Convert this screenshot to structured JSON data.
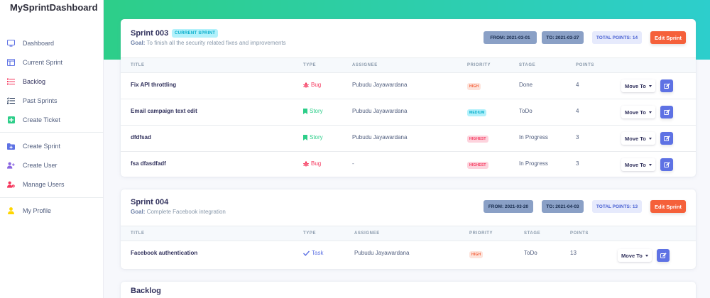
{
  "app": {
    "title": "MySprintDashboard",
    "accent": "#5e72e4",
    "hero_gradient": [
      "#2dce89",
      "#2dcecc"
    ]
  },
  "sidebar": {
    "items": [
      {
        "label": "Dashboard",
        "icon": "monitor-icon",
        "color": "#5e72e4"
      },
      {
        "label": "Current Sprint",
        "icon": "sprint-board-icon",
        "color": "#5e72e4"
      },
      {
        "label": "Backlog",
        "icon": "list-icon",
        "color": "#f5365c",
        "active": true
      },
      {
        "label": "Past Sprints",
        "icon": "checklist-icon",
        "color": "#172b4d"
      },
      {
        "label": "Create Ticket",
        "icon": "plus-square-icon",
        "color": "#2dce89"
      },
      {
        "label": "Create Sprint",
        "icon": "folder-plus-icon",
        "color": "#5e72e4"
      },
      {
        "label": "Create User",
        "icon": "user-plus-icon",
        "color": "#8965e0"
      },
      {
        "label": "Manage Users",
        "icon": "user-cog-icon",
        "color": "#f5365c"
      },
      {
        "label": "My Profile",
        "icon": "user-icon",
        "color": "#ffd600"
      }
    ]
  },
  "sprints": [
    {
      "title": "Sprint 003",
      "badge": "CURRENT SPRINT",
      "goal_label": "Goal:",
      "goal": "To finish all the security related fixes and improvements",
      "from": "FROM: 2021-03-01",
      "to": "TO: 2021-03-27",
      "points": "TOTAL POINTS: 14",
      "edit_label": "Edit Sprint",
      "columns": [
        "TITLE",
        "TYPE",
        "ASSIGNEE",
        "PRIORITY",
        "STAGE",
        "POINTS"
      ],
      "rows": [
        {
          "title": "Fix API throttling",
          "type": "Bug",
          "type_icon": "bug-icon",
          "assignee": "Pubudu Jayawardana",
          "priority": "HIGH",
          "stage": "Done",
          "points": "4",
          "move": "Move To"
        },
        {
          "title": "Email campaign text edit",
          "type": "Story",
          "type_icon": "bookmark-icon",
          "assignee": "Pubudu Jayawardana",
          "priority": "MEDIUM",
          "stage": "ToDo",
          "points": "4",
          "move": "Move To"
        },
        {
          "title": "dfdfsad",
          "type": "Story",
          "type_icon": "bookmark-icon",
          "assignee": "Pubudu Jayawardana",
          "priority": "HIGHEST",
          "stage": "In Progress",
          "points": "3",
          "move": "Move To"
        },
        {
          "title": "fsa dfasdfadf",
          "type": "Bug",
          "type_icon": "bug-icon",
          "assignee": "-",
          "priority": "HIGHEST",
          "stage": "In Progress",
          "points": "3",
          "move": "Move To"
        }
      ]
    },
    {
      "title": "Sprint 004",
      "goal_label": "Goal:",
      "goal": "Complete Facebook integration",
      "from": "FROM: 2021-03-20",
      "to": "TO: 2021-04-03",
      "points": "TOTAL POINTS: 13",
      "edit_label": "Edit Sprint",
      "columns": [
        "TITLE",
        "TYPE",
        "ASSIGNEE",
        "PRIORITY",
        "STAGE",
        "POINTS"
      ],
      "rows": [
        {
          "title": "Facebook authentication",
          "type": "Task",
          "type_icon": "check-icon",
          "assignee": "Pubudu Jayawardana",
          "priority": "HIGH",
          "stage": "ToDo",
          "points": "13",
          "move": "Move To"
        }
      ]
    }
  ],
  "backlog": {
    "title": "Backlog"
  }
}
